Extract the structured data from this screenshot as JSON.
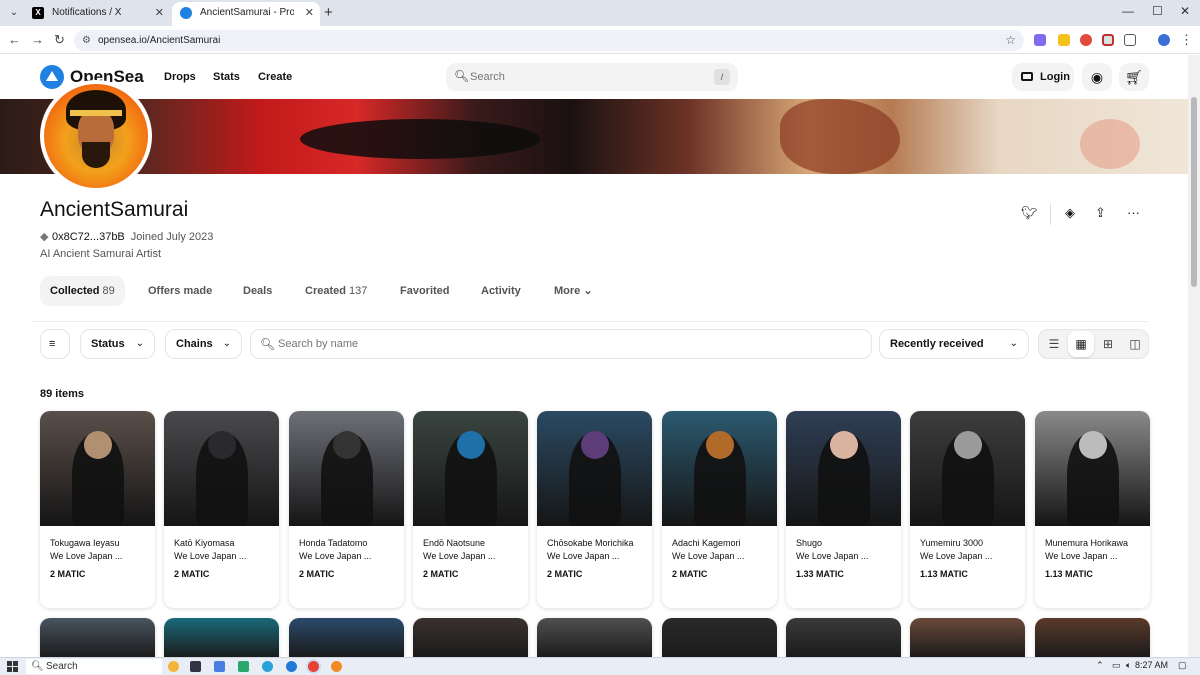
{
  "browser": {
    "tabs": [
      {
        "label": "Notifications / X",
        "favicon": "x-logo-icon",
        "active": false
      },
      {
        "label": "AncientSamurai - Profile | OpenSea",
        "favicon": "opensea-icon",
        "active": true
      }
    ],
    "url": "opensea.io/AncientSamurai"
  },
  "header": {
    "logo": "OpenSea",
    "nav": [
      "Drops",
      "Stats",
      "Create"
    ],
    "search_placeholder": "Search",
    "search_shortcut": "/",
    "login_label": "Login",
    "accent_color": "#2081e2"
  },
  "profile": {
    "name": "AncientSamurai",
    "address": "0x8C72...37bB",
    "joined": "Joined July 2023",
    "bio": "AI Ancient Samurai Artist",
    "actions": [
      "twitter-icon",
      "offer-icon",
      "share-icon",
      "more-icon"
    ]
  },
  "tabs": [
    {
      "label": "Collected",
      "count": "89",
      "active": true
    },
    {
      "label": "Offers made",
      "count": ""
    },
    {
      "label": "Deals",
      "count": ""
    },
    {
      "label": "Created",
      "count": "137"
    },
    {
      "label": "Favorited",
      "count": ""
    },
    {
      "label": "Activity",
      "count": ""
    },
    {
      "label": "More",
      "count": ""
    }
  ],
  "filters": {
    "status_label": "Status",
    "chains_label": "Chains",
    "search_placeholder": "Search by name",
    "sort_label": "Recently received",
    "view_modes": [
      "list-view-icon",
      "grid-view-icon",
      "large-grid-view-icon",
      "mosaic-view-icon"
    ],
    "active_view": "grid-view-icon"
  },
  "items_count": "89 items",
  "items": [
    {
      "title": "Tokugawa Ieyasu",
      "collection": "We Love Japan ...",
      "price": "2 MATIC",
      "bg": "#5a4f4a",
      "accent": "#b09070"
    },
    {
      "title": "Katō Kiyomasa",
      "collection": "We Love Japan ...",
      "price": "2 MATIC",
      "bg": "#4a4a4e",
      "accent": "#2a2a2e"
    },
    {
      "title": "Honda Tadatomo",
      "collection": "We Love Japan ...",
      "price": "2 MATIC",
      "bg": "#6e7078",
      "accent": "#333"
    },
    {
      "title": "Endō Naotsune",
      "collection": "We Love Japan ...",
      "price": "2 MATIC",
      "bg": "#3a4540",
      "accent": "#1f6fa8"
    },
    {
      "title": "Chōsokabe Morichika",
      "collection": "We Love Japan ...",
      "price": "2 MATIC",
      "bg": "#2b4a63",
      "accent": "#5c3d7a"
    },
    {
      "title": "Adachi Kagemori",
      "collection": "We Love Japan ...",
      "price": "2 MATIC",
      "bg": "#2c5a70",
      "accent": "#b26a2a"
    },
    {
      "title": "Shugo",
      "collection": "We Love Japan ...",
      "price": "1.33 MATIC",
      "bg": "#2f3f55",
      "accent": "#d9b3a0"
    },
    {
      "title": "Yumemiru 3000",
      "collection": "We Love Japan ...",
      "price": "1.13 MATIC",
      "bg": "#3d3d3d",
      "accent": "#9a9a9a"
    },
    {
      "title": "Munemura Horikawa",
      "collection": "We Love Japan ...",
      "price": "1.13 MATIC",
      "bg": "#8a8a8a",
      "accent": "#bcbcbc"
    }
  ],
  "row2_colors": [
    "#4a5560",
    "#1a6a7a",
    "#2a4a6a",
    "#3a3030",
    "#505050",
    "#2a2a2a",
    "#3a3a3a",
    "#6a4a3a",
    "#5a3a2a"
  ],
  "taskbar": {
    "search_label": "Search",
    "time": "8:27 AM"
  }
}
